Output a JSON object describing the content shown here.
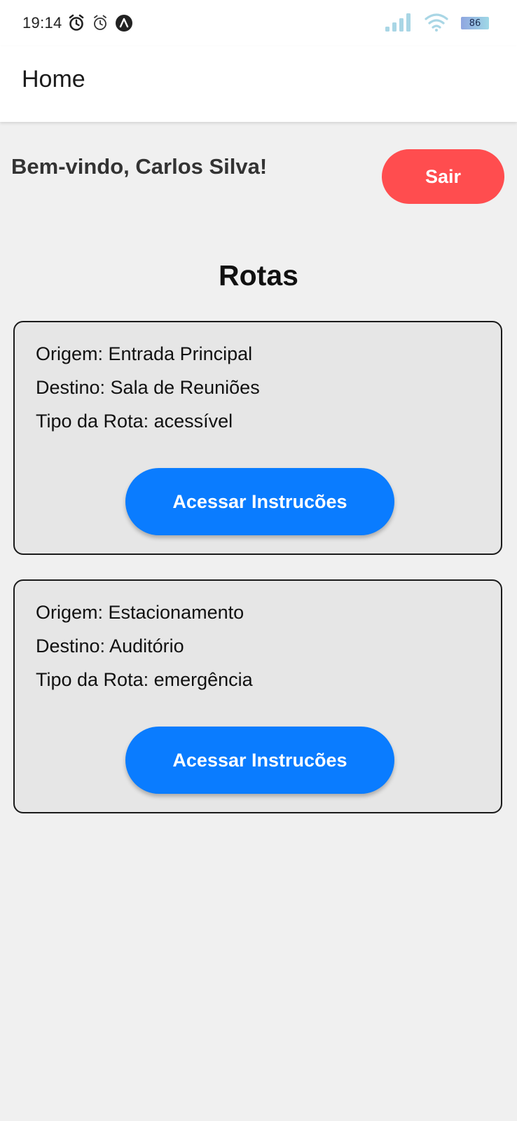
{
  "status_bar": {
    "time": "19:14",
    "battery": "86",
    "icons": [
      "alarm-icon",
      "alarm-clock-icon",
      "app-notification-icon",
      "signal-icon",
      "wifi-icon",
      "battery-icon"
    ]
  },
  "header": {
    "title": "Home"
  },
  "welcome": {
    "text": "Bem-vindo, Carlos Silva!",
    "logout_label": "Sair"
  },
  "routes": {
    "title": "Rotas",
    "items": [
      {
        "origin": "Origem: Entrada Principal",
        "destination": "Destino: Sala de Reuniões",
        "type": "Tipo da Rota: acessível",
        "button_label": "Acessar Instrucões"
      },
      {
        "origin": "Origem: Estacionamento",
        "destination": "Destino: Auditório",
        "type": "Tipo da Rota: emergência",
        "button_label": "Acessar Instrucões"
      }
    ]
  },
  "colors": {
    "logout_button": "#ff4d4f",
    "access_button": "#0a7cff",
    "card_background": "#e6e6e6",
    "page_background": "#f0f0f0"
  }
}
